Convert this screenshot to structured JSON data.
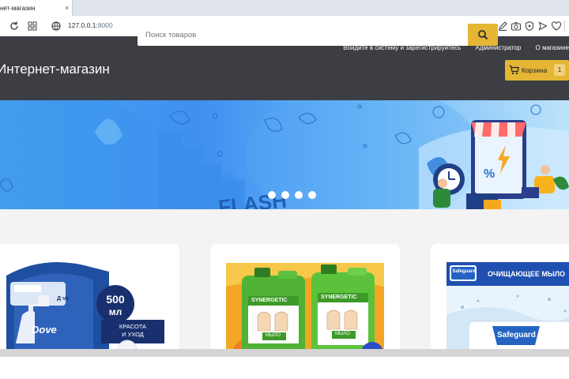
{
  "browser": {
    "tab_title": "нет-магазин",
    "url_host": "127.0.0.1:",
    "url_port": "8000",
    "icons": [
      "reload-icon",
      "apps-icon",
      "site-info-icon",
      "edit-icon",
      "camera-icon",
      "shield-icon",
      "send-icon",
      "heart-icon"
    ]
  },
  "header": {
    "login_link": "Войдите в систему и зарегистрируйтесь",
    "admin_link": "Администратор",
    "about_link": "О магазине",
    "logo": "Интернет-магазин",
    "search_placeholder": "Поиск товаров",
    "cart_label": "Корзина",
    "cart_count": "1"
  },
  "banner": {
    "text": "FLASH",
    "dots": 4,
    "colors": {
      "blue": "#3f8ff0",
      "light": "#bfe3fb"
    }
  },
  "products": [
    {
      "badge_value": "500",
      "badge_unit": "мл",
      "brand": "Dove",
      "caption_1": "КРАСОТА",
      "caption_2": "И УХОД",
      "side_tag": "Д·ve"
    },
    {
      "brand_1": "SYNERGETIC",
      "brand_2": "SYNERGETIC",
      "label_1": "МЫЛО",
      "label_2": "МЫЛО"
    },
    {
      "brand": "Safeguard",
      "headline": "ОЧИЩАЮЩЕЕ МЫЛО",
      "product_brand": "Safeguard"
    }
  ],
  "colors": {
    "header_bg": "#3c3e43",
    "accent": "#e4b634",
    "page_bg": "#f3f3f3"
  }
}
